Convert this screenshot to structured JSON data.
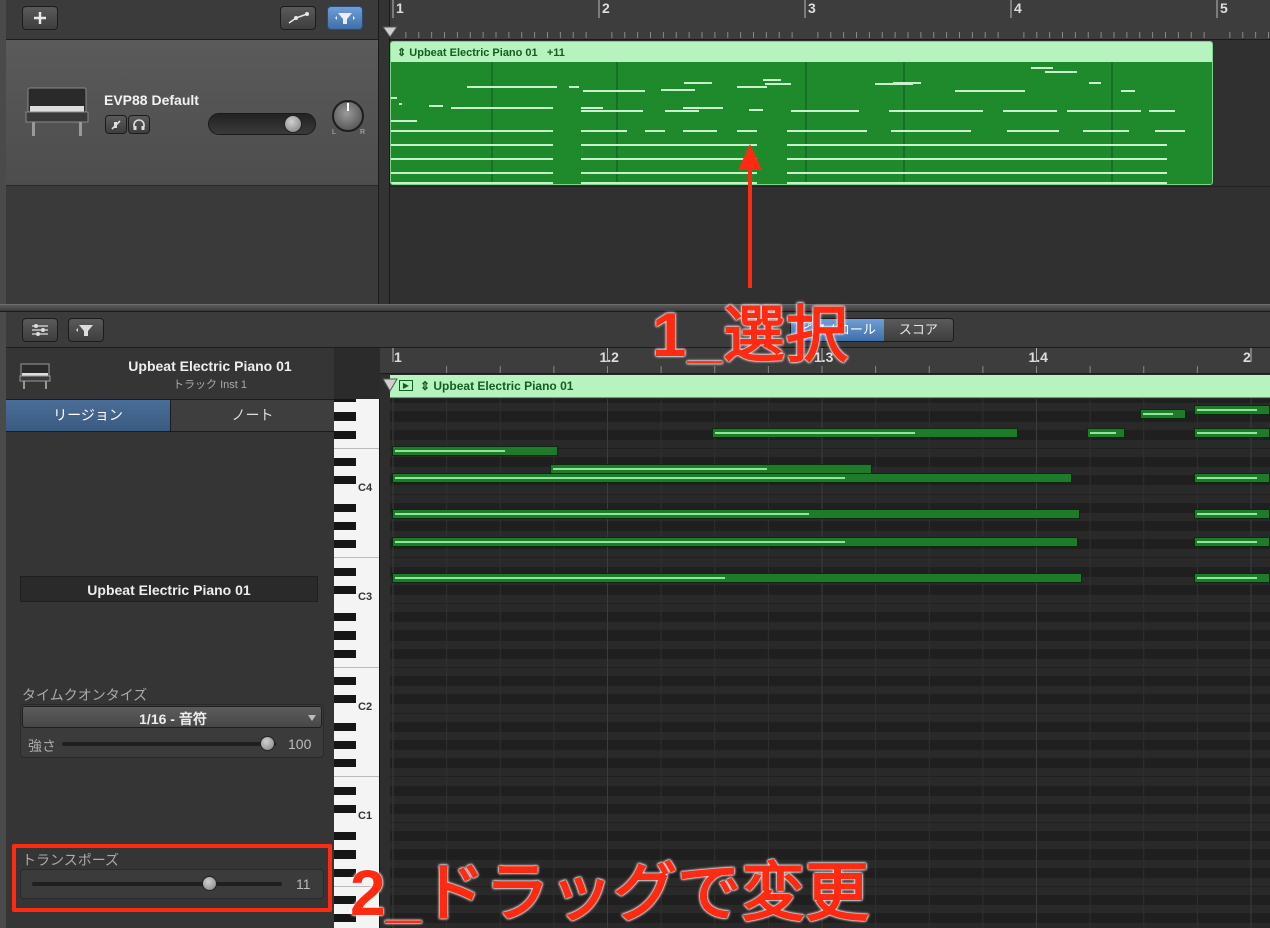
{
  "top_toolbar": {
    "add_icon": "plus-icon",
    "automation_icon": "automation-curve-icon",
    "filter_icon": "filter-funnel-icon"
  },
  "top_ruler": {
    "bars": [
      "1",
      "2",
      "3",
      "4",
      "5"
    ]
  },
  "track": {
    "name": "EVP88 Default",
    "icon": "electric-piano-icon",
    "mute_icon": "mute-icon",
    "headphone_icon": "headphones-icon",
    "volume_level": 0.85,
    "pan_labels": {
      "left": "L",
      "right": "R"
    }
  },
  "region": {
    "name": "Upbeat Electric Piano 01",
    "transpose_badge": "+11",
    "color": "#1f8a2c"
  },
  "annotation1": {
    "text": "1_選択",
    "color": "#ff2a12"
  },
  "editor_toolbar": {
    "settings_icon": "sliders-icon",
    "filter_icon": "filter-funnel-icon",
    "tabs": [
      {
        "label": "ピアノロール"
      },
      {
        "label": "スコア"
      }
    ],
    "active_tab": 0
  },
  "editor_header": {
    "title": "Upbeat Electric Piano 01",
    "subtitle": "トラック Inst 1"
  },
  "inspector": {
    "tabs": [
      "リージョン",
      "ノート"
    ],
    "active_tab": 0,
    "region_name": "Upbeat Electric Piano 01",
    "quantize_label": "タイムクオンタイズ",
    "quantize_value": "1/16 - 音符",
    "strength_label": "強さ",
    "strength_value": "100",
    "strength_level": 1.0,
    "transpose_label": "トランスポーズ",
    "transpose_value": "11",
    "transpose_level": 0.72
  },
  "editor_ruler": {
    "marks": [
      "1",
      "1.2",
      "1.3",
      "1.4",
      "2"
    ]
  },
  "piano_keys": {
    "labels": [
      "C4",
      "C3",
      "C2",
      "C1"
    ]
  },
  "editor_region": {
    "name": "Upbeat Electric Piano 01"
  },
  "annotation2": {
    "text": "2_ドラッグで変更",
    "color": "#ff2a12"
  }
}
